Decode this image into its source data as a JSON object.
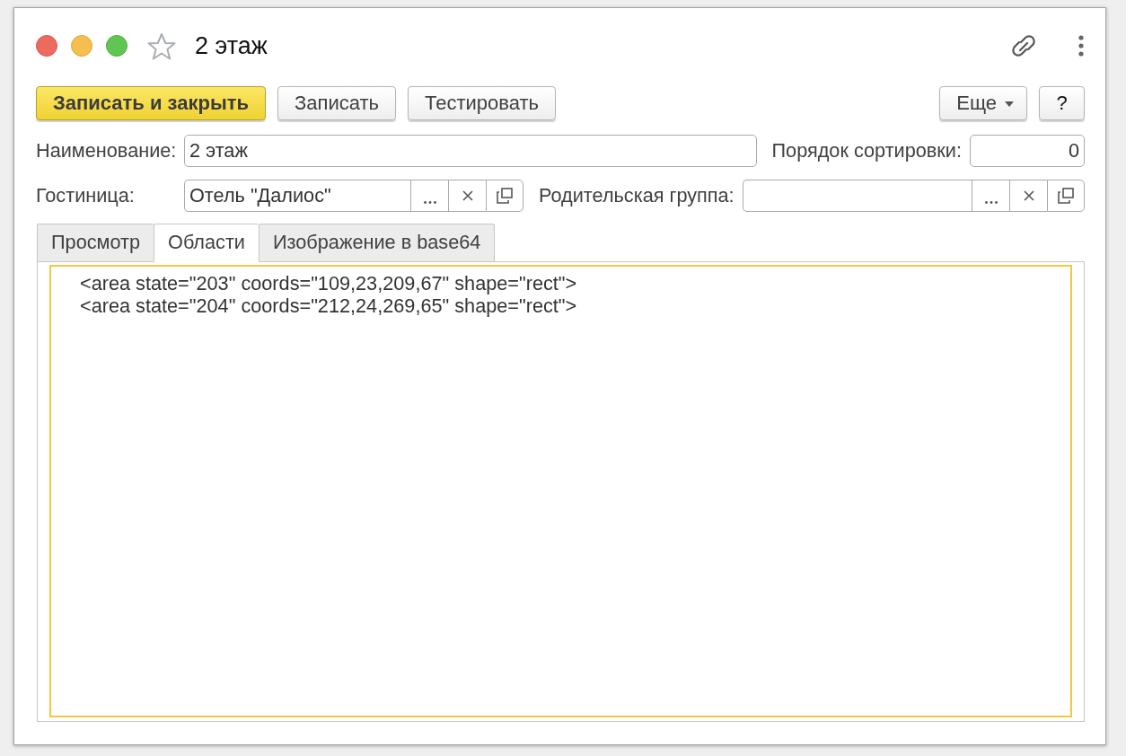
{
  "window": {
    "title": "2 этаж",
    "favorite": false
  },
  "toolbar": {
    "buttons": [
      {
        "label": "Записать и закрыть",
        "kind": "default"
      },
      {
        "label": "Записать",
        "kind": "normal"
      },
      {
        "label": "Тестировать",
        "kind": "normal"
      }
    ],
    "more": {
      "label": "Еще"
    },
    "help": {
      "label": "?"
    }
  },
  "form": {
    "name": {
      "label": "Наименование:",
      "value": "2 этаж"
    },
    "sort_order": {
      "label": "Порядок сортировки:",
      "value": "0"
    },
    "hotel": {
      "label": "Гостиница:",
      "value": "Отель \"Далиос\""
    },
    "parent_group": {
      "label": "Родительская группа:"
    }
  },
  "tabs": [
    {
      "label": "Просмотр",
      "selected": false
    },
    {
      "label": "Области",
      "selected": true
    },
    {
      "label": "Изображение в base64",
      "selected": false
    }
  ],
  "editor": {
    "lines": [
      "<area state=\"203\" coords=\"109,23,209,67\" shape=\"rect\">",
      "<area state=\"204\" coords=\"212,24,269,65\" shape=\"rect\">"
    ]
  }
}
